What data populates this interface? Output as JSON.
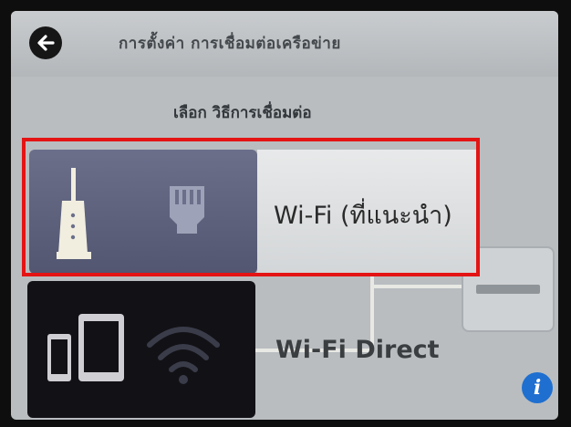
{
  "header": {
    "title": "การตั้งค่า การเชื่อมต่อเครือข่าย"
  },
  "subtitle": "เลือก วิธีการเชื่อมต่อ",
  "options": [
    {
      "label": "Wi-Fi (ที่แนะนำ)",
      "selected": true
    },
    {
      "label": "Wi-Fi Direct",
      "selected": false
    }
  ],
  "icons": {
    "back": "arrow-left-icon",
    "router": "router-icon",
    "ethernet": "ethernet-icon",
    "devices": "phone-tablet-icon",
    "wifi": "wifi-icon",
    "info": "info-icon",
    "printer": "printer-icon"
  },
  "info_glyph": "i",
  "colors": {
    "highlight": "#e41414",
    "info": "#1e6fd0"
  }
}
